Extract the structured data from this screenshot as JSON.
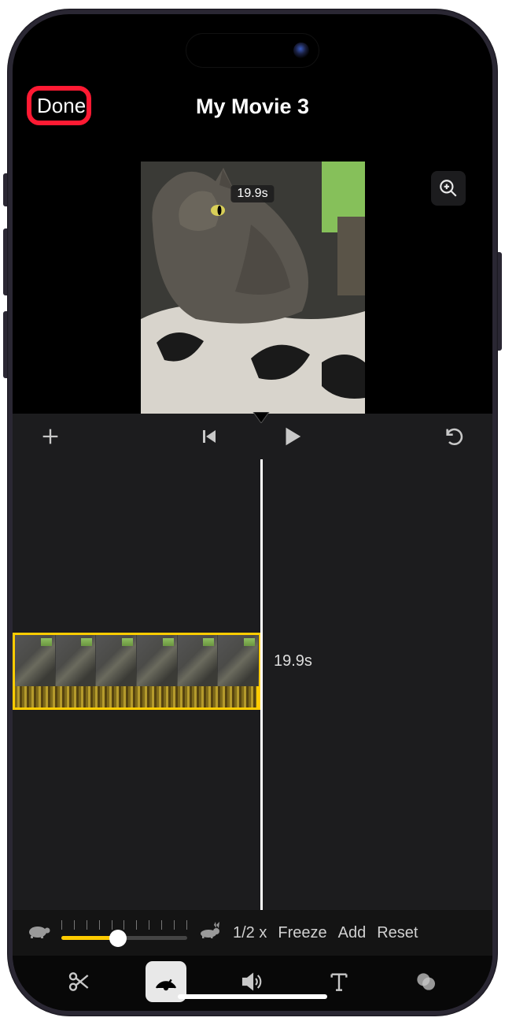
{
  "header": {
    "done_label": "Done",
    "title": "My Movie 3"
  },
  "preview": {
    "duration_badge": "19.9s"
  },
  "timeline": {
    "clip_duration": "19.9s"
  },
  "speed": {
    "multiplier_label": "1/2 x",
    "freeze_label": "Freeze",
    "add_label": "Add",
    "reset_label": "Reset"
  },
  "icons": {
    "zoom": "magnifier-plus",
    "add_media": "plus",
    "skip_back": "skip-back",
    "play": "play",
    "undo": "undo",
    "turtle": "turtle",
    "rabbit": "rabbit",
    "cut": "scissors",
    "speed_gauge": "speedometer",
    "volume": "speaker",
    "text": "T",
    "filters": "filters"
  }
}
